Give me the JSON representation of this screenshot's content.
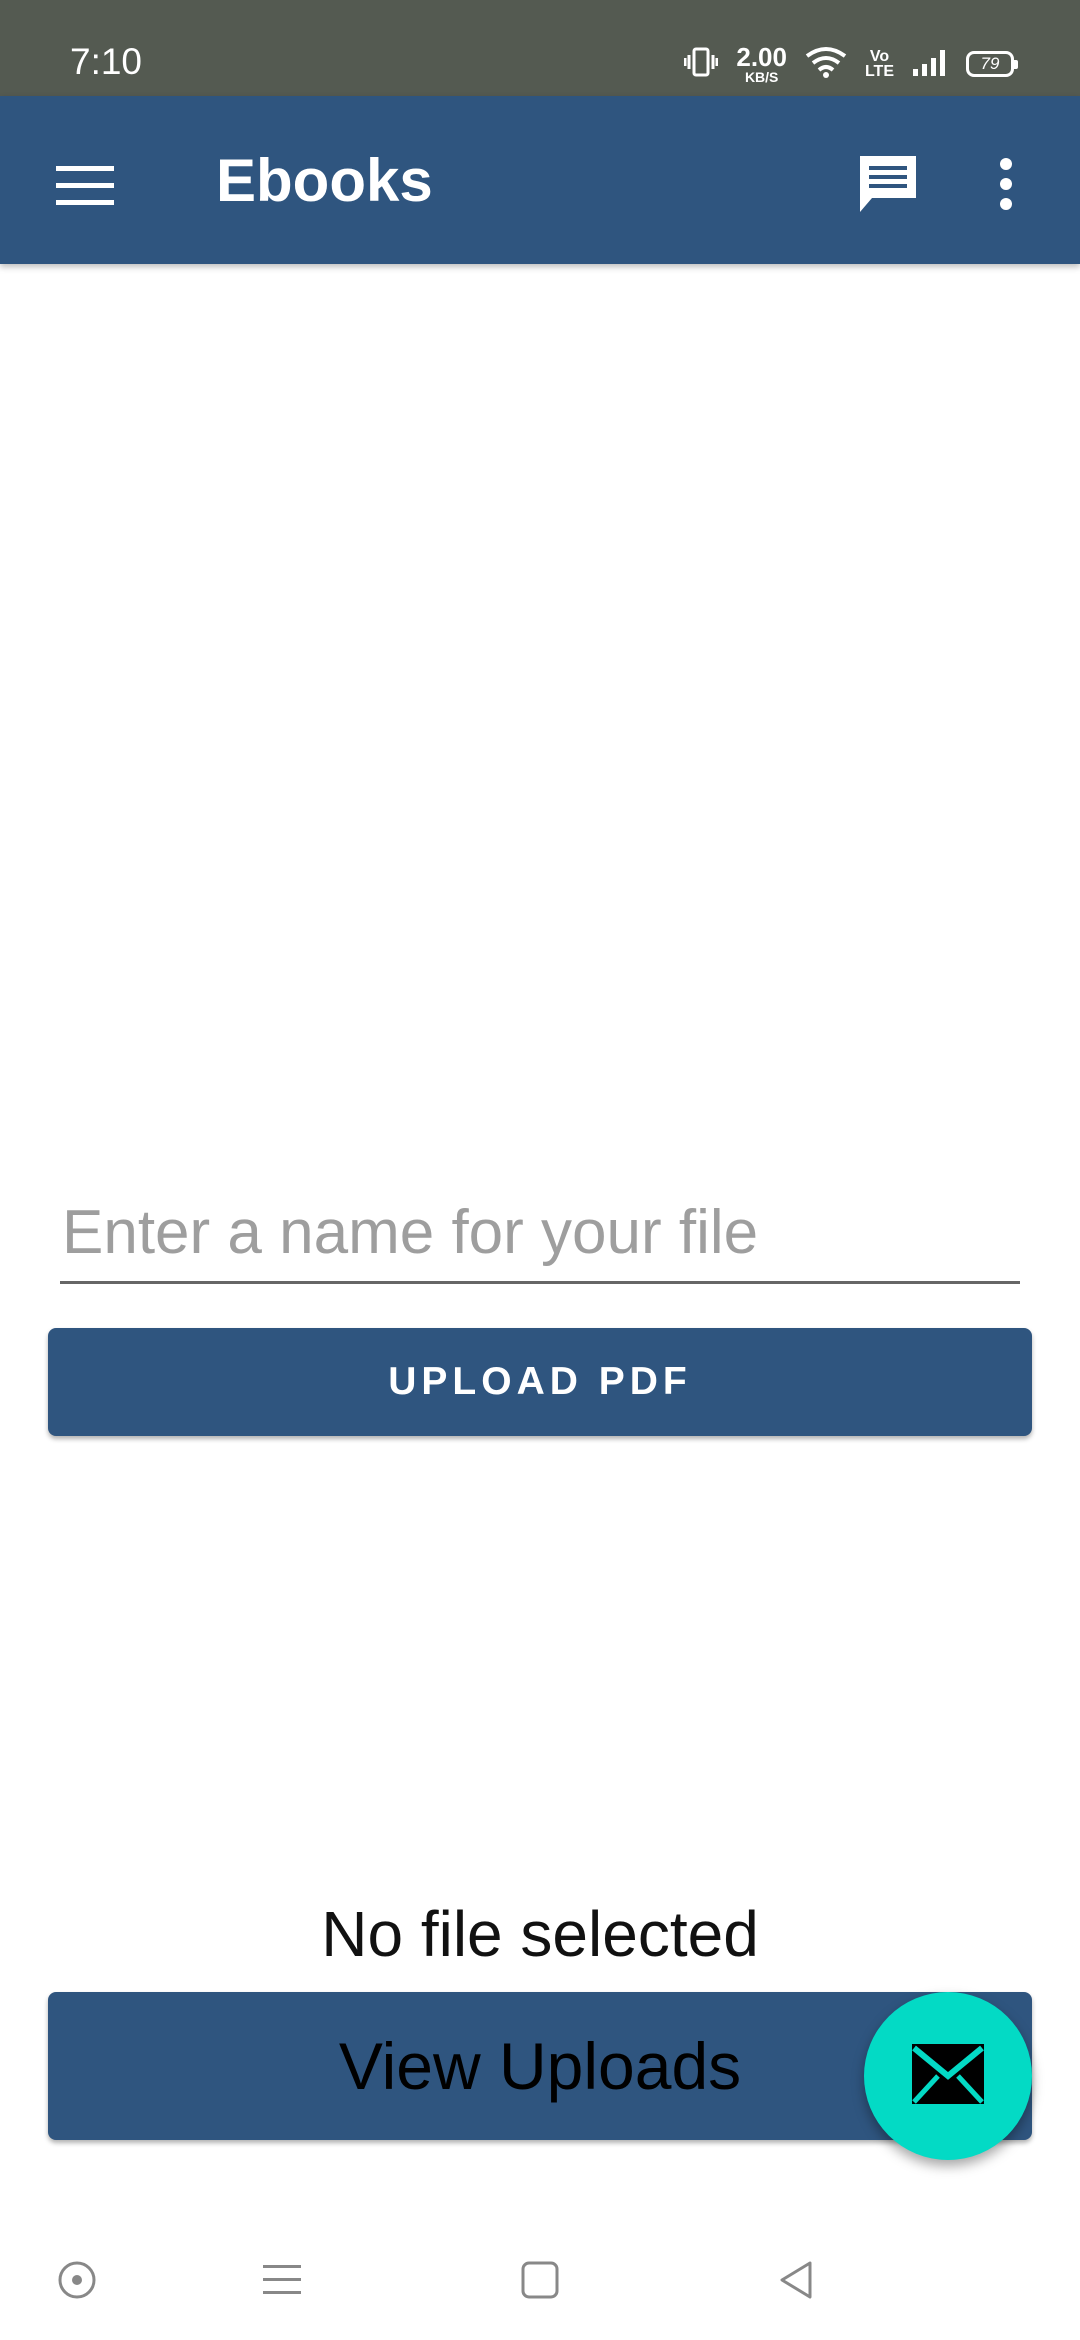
{
  "status_bar": {
    "time": "7:10",
    "net_speed_value": "2.00",
    "net_speed_unit": "KB/S",
    "volte_line1": "Vo",
    "volte_line2": "LTE",
    "battery": "79",
    "icons": [
      "vibrate-icon",
      "wifi-icon",
      "signal-icon",
      "battery-icon"
    ]
  },
  "app_bar": {
    "title": "Ebooks",
    "icons": [
      "menu-icon",
      "chat-icon",
      "more-vert-icon"
    ],
    "color": "#2f557f"
  },
  "form": {
    "file_name_placeholder": "Enter a name for your file",
    "file_name_value": "",
    "upload_label": "UPLOAD PDF"
  },
  "file_status": "No file selected",
  "view_uploads_label": "View Uploads",
  "fab": {
    "icon": "mail-icon",
    "color": "#03dac5"
  },
  "nav_bar": {
    "icons": [
      "assistant-icon",
      "recents-icon",
      "home-icon",
      "back-icon"
    ]
  }
}
